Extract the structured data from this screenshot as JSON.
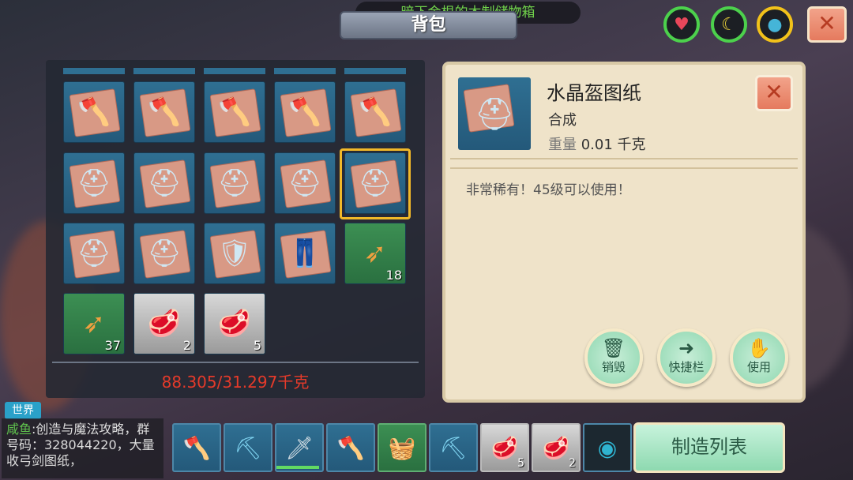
{
  "header": {
    "title": "背包",
    "notice": "暗下金根的木制储物箱",
    "status": {
      "health_icon": "heart-icon",
      "hunger_icon": "banana-icon",
      "water_icon": "water-drop-icon"
    },
    "close_glyph": "✕"
  },
  "inventory": {
    "weight": "88.305/31.297千克",
    "rows": [
      [
        {
          "icon": "axe-blueprint",
          "count": ""
        },
        {
          "icon": "axe-blueprint",
          "count": ""
        },
        {
          "icon": "axe-blueprint",
          "count": ""
        },
        {
          "icon": "axe-blueprint",
          "count": ""
        },
        {
          "icon": "axe-blueprint",
          "count": ""
        }
      ],
      [
        {
          "icon": "helmet-blueprint",
          "count": ""
        },
        {
          "icon": "helmet-blueprint",
          "count": ""
        },
        {
          "icon": "helmet-blueprint",
          "count": ""
        },
        {
          "icon": "helmet-blueprint",
          "count": ""
        },
        {
          "icon": "helmet-blueprint",
          "count": "",
          "selected": true
        }
      ],
      [
        {
          "icon": "helmet-blueprint",
          "count": ""
        },
        {
          "icon": "helmet-blueprint",
          "count": ""
        },
        {
          "icon": "chest-armor-blueprint",
          "count": ""
        },
        {
          "icon": "leg-armor-blueprint",
          "count": ""
        },
        {
          "icon": "arrow",
          "count": "18"
        }
      ],
      [
        {
          "icon": "arrow",
          "count": "37"
        },
        {
          "icon": "raw-meat",
          "count": "2"
        },
        {
          "icon": "raw-meat",
          "count": "5"
        }
      ]
    ]
  },
  "detail": {
    "name": "水晶盔图纸",
    "type": "合成",
    "weight_label": "重量",
    "weight_value": "0.01 千克",
    "description": "非常稀有！45级可以使用！",
    "close_glyph": "✕",
    "buttons": {
      "destroy": "销毁",
      "hotbar": "快捷栏",
      "use": "使用"
    }
  },
  "chat": {
    "tag": "世界",
    "sender": "咸鱼",
    "message": ":创造与魔法攻略，群号码：328044220，大量收弓剑图纸，"
  },
  "hotbar": {
    "slots": [
      {
        "icon": "axe",
        "count": ""
      },
      {
        "icon": "pickaxe",
        "count": ""
      },
      {
        "icon": "sword",
        "count": ""
      },
      {
        "icon": "axe",
        "count": ""
      },
      {
        "icon": "basket",
        "count": ""
      },
      {
        "icon": "pickaxe",
        "count": ""
      },
      {
        "icon": "raw-meat",
        "count": "5"
      },
      {
        "icon": "raw-meat",
        "count": "2"
      },
      {
        "icon": "crystal-orb",
        "count": ""
      }
    ],
    "craft_list": "制造列表"
  }
}
